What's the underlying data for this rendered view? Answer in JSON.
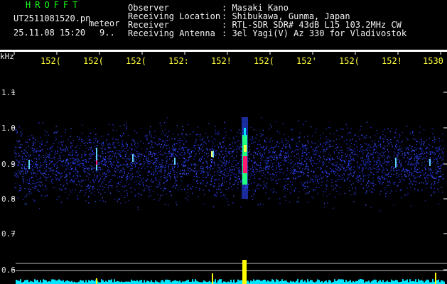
{
  "header": {
    "logo": "HROFFT",
    "filename": "UT2511081520.pn",
    "classification": "meteor",
    "datetime": "25.11.08 15:20",
    "count": "9.."
  },
  "info": {
    "observer_label": "Observer",
    "observer_value": ": Masaki Kano",
    "location_label": "Receiving Location",
    "location_value": ": Shibukawa, Gunma, Japan",
    "receiver_label": "Receiver",
    "receiver_value": ": RTL-SDR SDR# 43dB L15 103.2MHz CW",
    "antenna_label": "Receiving Antenna",
    "antenna_value": ": 3el Yagi(V) Az 330 for Vladivostok"
  },
  "axes": {
    "y_unit": "kHz",
    "y_labels": [
      "1.1",
      "1.0",
      "0.9",
      "0.8",
      "0.7",
      "0.6"
    ],
    "x_labels": [
      "152(",
      "152(",
      "152(",
      "152:",
      "152!",
      "152(",
      "152'",
      "152(",
      "152!",
      "1530"
    ]
  },
  "colors": {
    "noise": "#2a3cff",
    "echo_core": "#ff1a6e",
    "echo_mid": "#20ff80",
    "amplitude": "#00e5ff",
    "amplitude_peak": "#ffff00"
  }
}
